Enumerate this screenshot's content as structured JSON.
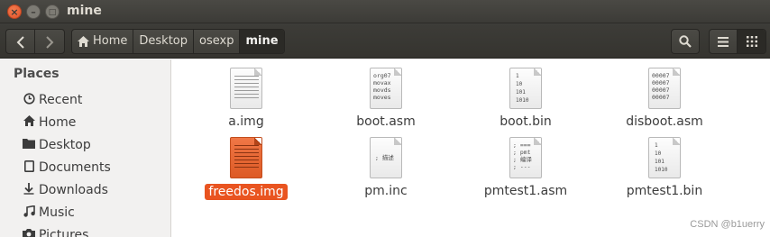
{
  "window": {
    "title": "mine"
  },
  "toolbar": {
    "breadcrumbs": [
      "Home",
      "Desktop",
      "osexp",
      "mine"
    ],
    "search_icon": "search-icon",
    "view_list_icon": "list-view-icon",
    "view_grid_icon": "grid-view-icon"
  },
  "sidebar": {
    "heading": "Places",
    "items": [
      {
        "label": "Recent",
        "icon": "clock-icon"
      },
      {
        "label": "Home",
        "icon": "home-icon"
      },
      {
        "label": "Desktop",
        "icon": "folder-icon"
      },
      {
        "label": "Documents",
        "icon": "document-icon"
      },
      {
        "label": "Downloads",
        "icon": "download-icon"
      },
      {
        "label": "Music",
        "icon": "music-icon"
      },
      {
        "label": "Pictures",
        "icon": "camera-icon"
      }
    ]
  },
  "files": [
    {
      "name": "a.img",
      "preview": ""
    },
    {
      "name": "boot.asm",
      "preview": "org07\nmovax\nmovds\nmoves"
    },
    {
      "name": "boot.bin",
      "preview": "1\n10\n101\n1010"
    },
    {
      "name": "disboot.asm",
      "preview": "00007\n00007\n00007\n00007"
    },
    {
      "name": "freedos.img",
      "preview": "",
      "selected": true
    },
    {
      "name": "pm.inc",
      "preview": "; 描述"
    },
    {
      "name": "pmtest1.asm",
      "preview": "; ===\n; pmt\n; 编译\n; ---"
    },
    {
      "name": "pmtest1.bin",
      "preview": "1\n10\n101\n1010"
    }
  ],
  "watermark": "CSDN @b1uerry",
  "colors": {
    "accent": "#e95420",
    "titlebar": "#3c3b37",
    "sidebar": "#f2f1f0"
  }
}
